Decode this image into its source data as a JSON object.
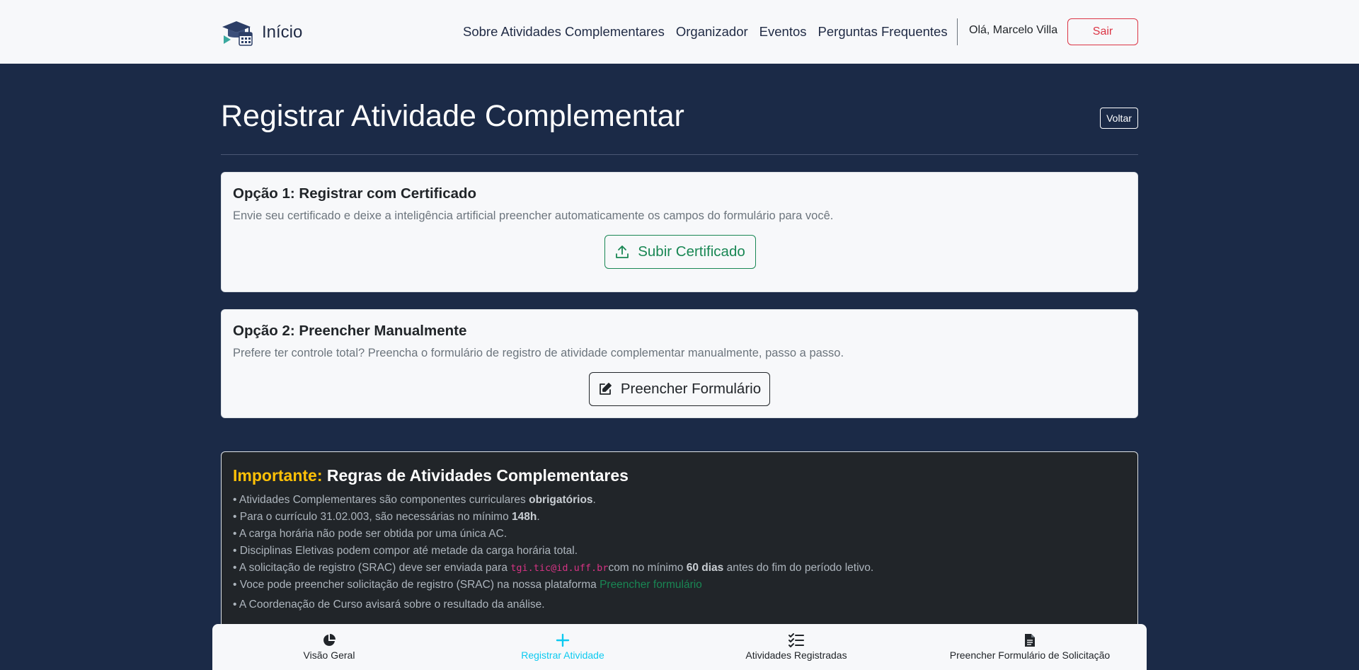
{
  "navbar": {
    "brand_label": "Início",
    "links": [
      "Sobre Atividades Complementares",
      "Organizador",
      "Eventos",
      "Perguntas Frequentes"
    ],
    "greeting": "Olá, Marcelo Villa",
    "logout_label": "Sair"
  },
  "page": {
    "title": "Registrar Atividade Complementar",
    "back_label": "Voltar"
  },
  "option1": {
    "title": "Opção 1: Registrar com Certificado",
    "description": "Envie seu certificado e deixe a inteligência artificial preencher automaticamente os campos do formulário para você.",
    "button_label": "Subir Certificado",
    "icon": "upload-icon"
  },
  "option2": {
    "title": "Opção 2: Preencher Manualmente",
    "description": "Prefere ter controle total? Preencha o formulário de registro de atividade complementar manualmente, passo a passo.",
    "button_label": "Preencher Formulário",
    "icon": "edit-icon"
  },
  "rules": {
    "title_prefix": "Importante:",
    "title_rest": " Regras de Atividades Complementares",
    "r1_pre": "• Atividades Complementares são componentes curriculares ",
    "r1_bold": "obrigatórios",
    "r1_post": ".",
    "r2_pre": "• Para o currículo 31.02.003, são necessárias no mínimo ",
    "r2_bold": "148h",
    "r2_post": ".",
    "r3": "• A carga horária não pode ser obtida por uma única AC.",
    "r4": "• Disciplinas Eletivas podem compor até metade da carga horária total.",
    "r5_pre": "• A solicitação de registro (SRAC) deve ser enviada para ",
    "r5_code": "tgi.tic@id.uff.br",
    "r5_mid": "com no mínimo ",
    "r5_bold": "60 dias",
    "r5_post": " antes do fim do período letivo.",
    "r6_pre": "• Voce pode preencher solicitação de registro (SRAC) na nossa plataforma ",
    "r6_link": "Preencher formulário",
    "r7": "• A Coordenação de Curso avisará sobre o resultado da análise."
  },
  "tabbar": {
    "tabs": [
      {
        "label": "Visão Geral",
        "icon": "pie-chart-icon"
      },
      {
        "label": "Registrar Atividade",
        "icon": "plus-icon"
      },
      {
        "label": "Atividades Registradas",
        "icon": "checklist-icon"
      },
      {
        "label": "Preencher Formulário de Solicitação",
        "icon": "document-icon"
      }
    ],
    "active_index": 1
  },
  "colors": {
    "background": "#1b2a47",
    "success": "#198754",
    "danger": "#dc3545",
    "warning": "#ffc107",
    "info": "#0dcaf0"
  }
}
